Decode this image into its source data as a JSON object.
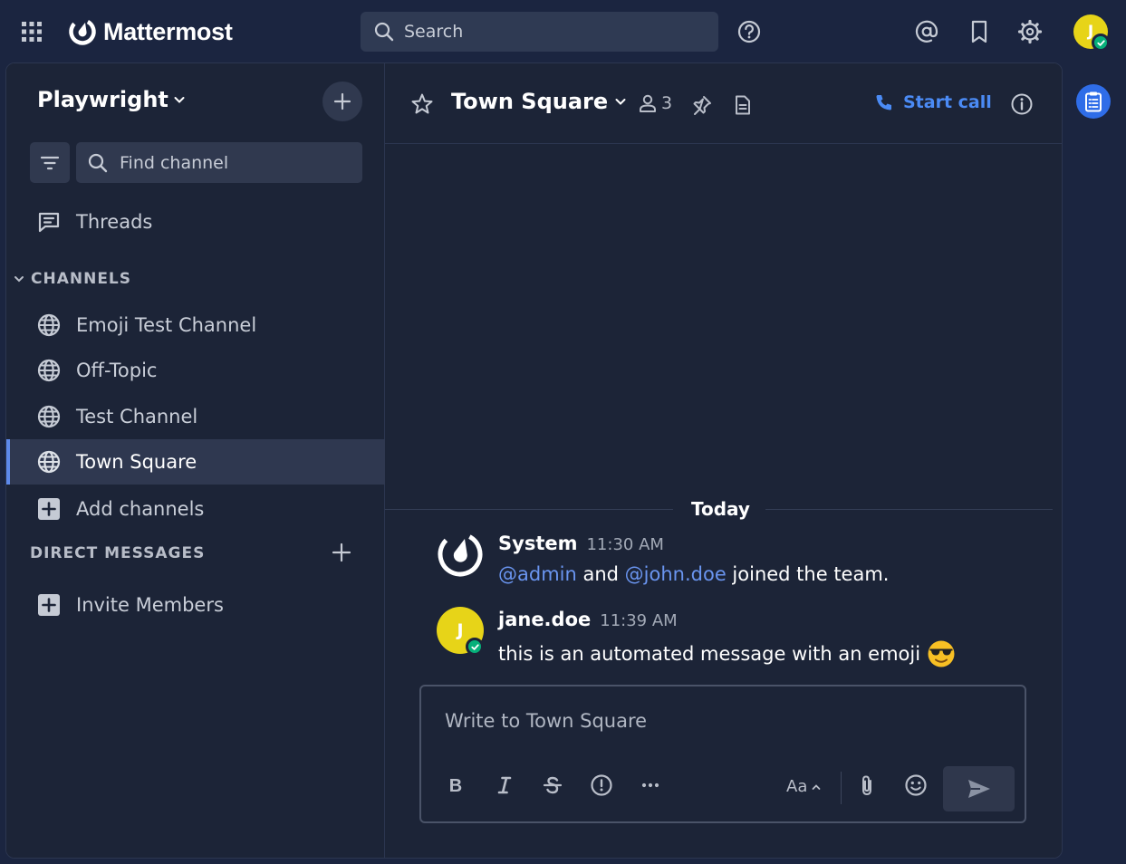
{
  "app": {
    "brand": "Mattermost",
    "search_placeholder": "Search",
    "user_initial": "J",
    "colors": {
      "accent": "#4b8bf5",
      "online": "#06b07a",
      "avatar": "#e7d418",
      "background": "#1b2540"
    }
  },
  "header_icons": [
    "product-menu-icon",
    "help-icon",
    "mentions-icon",
    "saved-messages-icon",
    "settings-icon"
  ],
  "sidebar": {
    "team_name": "Playwright",
    "find_channel_placeholder": "Find channel",
    "threads_label": "Threads",
    "channels_header": "CHANNELS",
    "channels": [
      {
        "label": "Emoji Test Channel",
        "active": false
      },
      {
        "label": "Off-Topic",
        "active": false
      },
      {
        "label": "Test Channel",
        "active": false
      },
      {
        "label": "Town Square",
        "active": true
      }
    ],
    "add_channels_label": "Add channels",
    "dm_header": "DIRECT MESSAGES",
    "invite_members_label": "Invite Members"
  },
  "channel": {
    "name": "Town Square",
    "member_count": "3",
    "start_call_label": "Start call",
    "date_separator": "Today"
  },
  "posts": [
    {
      "author": "System",
      "time": "11:30 AM",
      "mention_1": "@admin",
      "text_1": " and ",
      "mention_2": "@john.doe",
      "text_2": " joined the team."
    },
    {
      "author": "jane.doe",
      "avatar_initial": "J",
      "time": "11:39 AM",
      "text": "this is an automated message with an emoji ",
      "emoji": "sunglasses"
    }
  ],
  "composer": {
    "placeholder": "Write to Town Square",
    "format_label": "Aa",
    "format_tools": [
      "bold",
      "italic",
      "strikethrough",
      "priority",
      "more"
    ]
  }
}
